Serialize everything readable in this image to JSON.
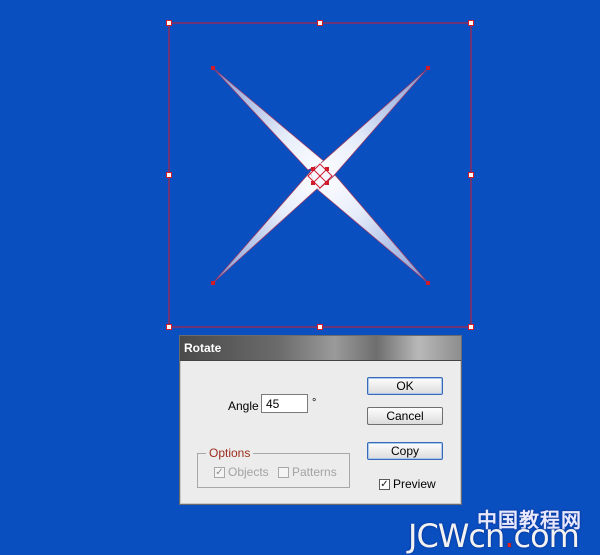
{
  "dialog": {
    "title": "Rotate",
    "angle_label": "Angle",
    "angle_value": "45",
    "degree_symbol": "°",
    "buttons": {
      "ok": "OK",
      "cancel": "Cancel",
      "copy": "Copy"
    },
    "options": {
      "legend": "Options",
      "objects_label": "Objects",
      "objects_checked": true,
      "patterns_label": "Patterns",
      "patterns_checked": false
    },
    "preview_label": "Preview",
    "preview_checked": true
  },
  "watermark": {
    "cn": "中国教程网",
    "en_a": "JCWcn",
    "en_dot": ".",
    "en_b": "com"
  },
  "colors": {
    "background": "#0a4fc0",
    "selection": "#d11b2b",
    "shape_light": "#ffffff",
    "shape_dark": "#8aa4d8"
  }
}
